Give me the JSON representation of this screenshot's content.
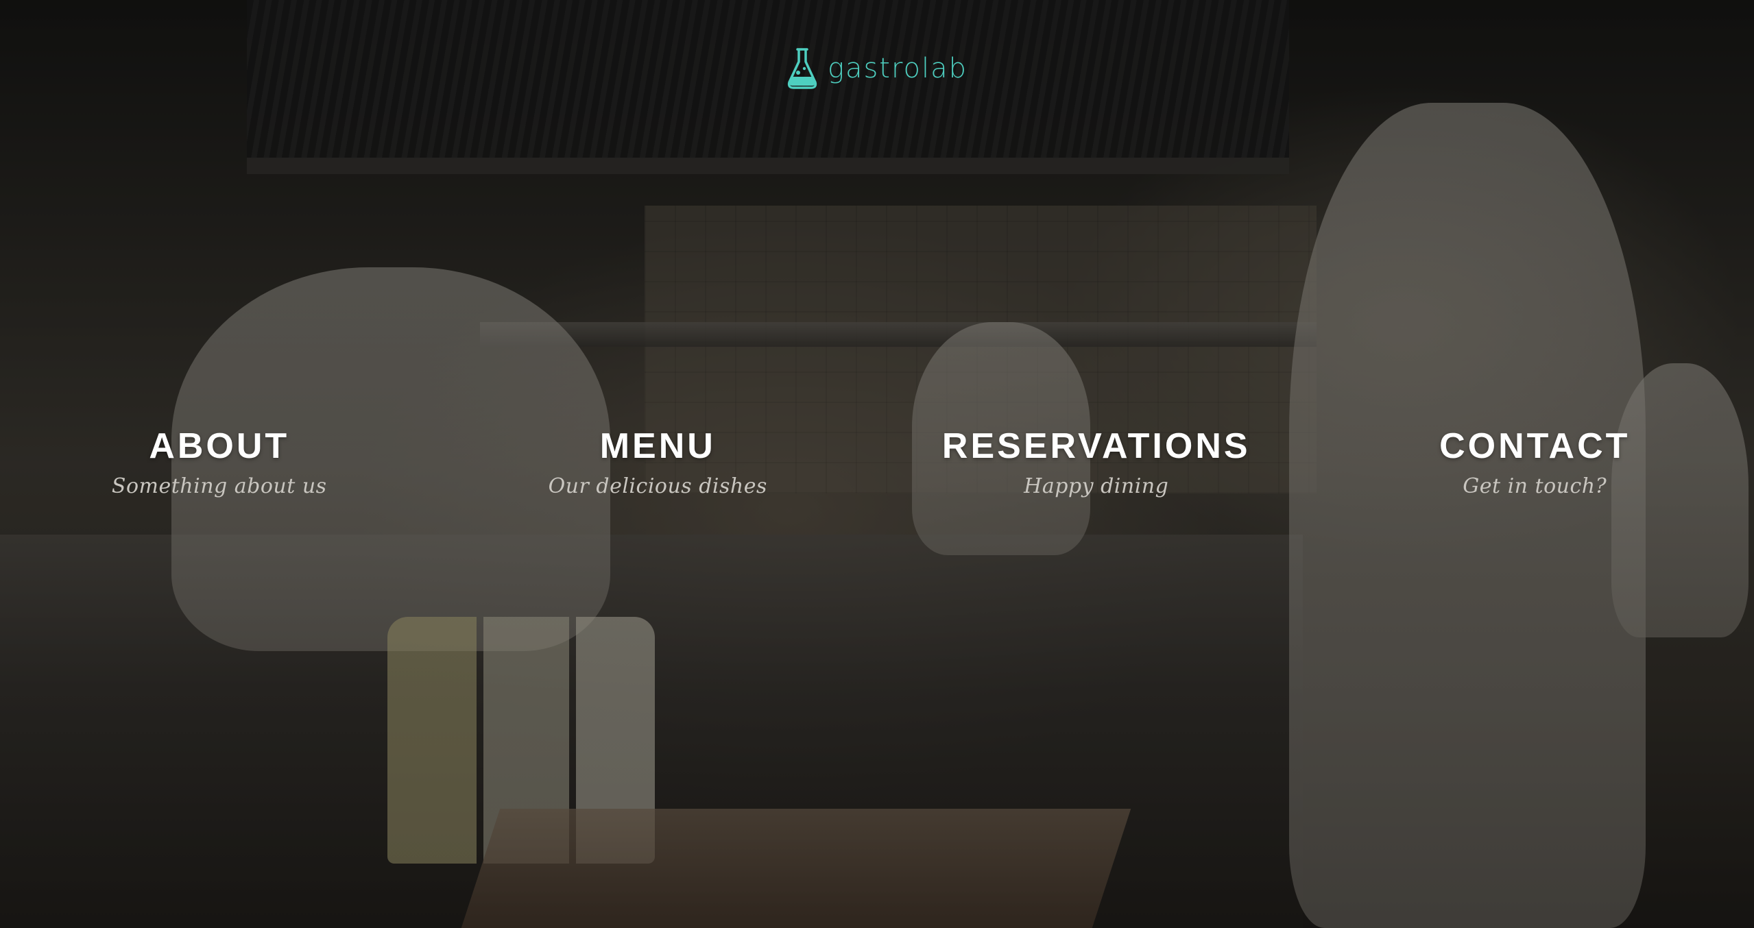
{
  "brand": {
    "name": "gastrolab",
    "icon": "flask-icon",
    "color": "#4ecfc0"
  },
  "nav": {
    "items": [
      {
        "title": "ABOUT",
        "subtitle": "Something about us"
      },
      {
        "title": "MENU",
        "subtitle": "Our delicious dishes"
      },
      {
        "title": "RESERVATIONS",
        "subtitle": "Happy dining"
      },
      {
        "title": "CONTACT",
        "subtitle": "Get in touch?"
      }
    ]
  },
  "colors": {
    "title": "#ffffff",
    "subtitle": "#c9c6c0"
  }
}
